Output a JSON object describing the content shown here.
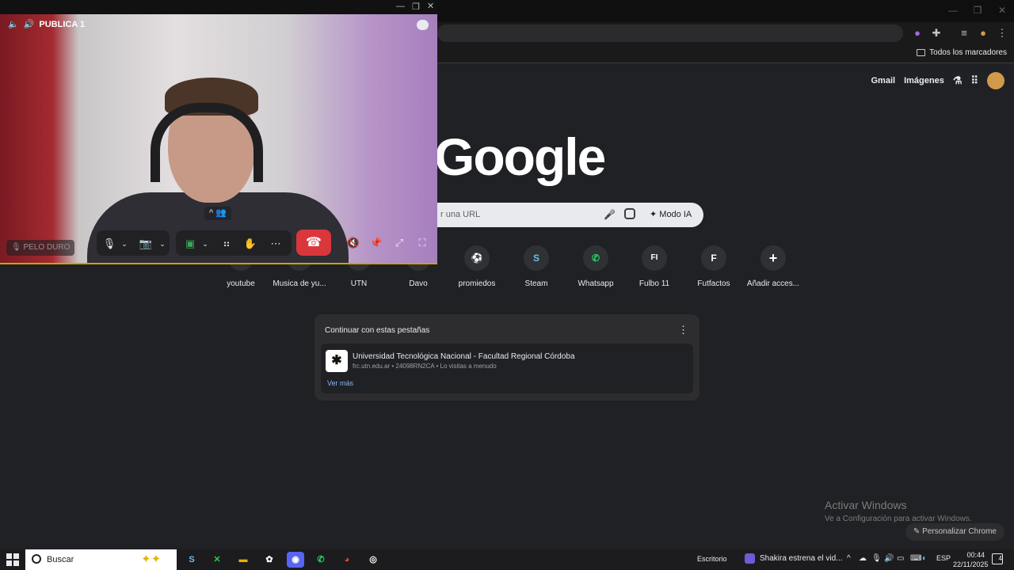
{
  "chrome": {
    "bookmarks_all": "Todos los marcadores",
    "topnav": {
      "gmail": "Gmail",
      "images": "Imágenes"
    },
    "logo": "Google",
    "search_placeholder": "r una URL",
    "mode_ai": "Modo IA",
    "shortcuts": [
      {
        "label": "youtube",
        "icon": "youtube-icon"
      },
      {
        "label": "Musica de yu...",
        "icon": "music-icon"
      },
      {
        "label": "UTN",
        "icon": "utn-icon"
      },
      {
        "label": "Davo",
        "icon": "davo-icon"
      },
      {
        "label": "promiedos",
        "icon": "soccer-ball-icon",
        "glyph": "⚽"
      },
      {
        "label": "Steam",
        "icon": "steam-icon",
        "glyph": "S"
      },
      {
        "label": "Whatsapp",
        "icon": "whatsapp-icon",
        "glyph": "✆"
      },
      {
        "label": "Fulbo 11",
        "icon": "fulbo-icon",
        "glyph": "FI"
      },
      {
        "label": "Futfactos",
        "icon": "futfactos-icon",
        "glyph": "F"
      },
      {
        "label": "Añadir acces...",
        "icon": "plus-icon",
        "glyph": "+"
      }
    ],
    "continue_card": {
      "title": "Continuar con estas pestañas",
      "item_name": "Universidad Tecnológica Nacional - Facultad Regional Córdoba",
      "item_meta": "frc.utn.edu.ar • 24098RN2CA • Lo visitas a menudo",
      "link": "Ver más"
    },
    "customize": "Personalizar Chrome"
  },
  "watermark": {
    "line1": "Activar Windows",
    "line2": "Ve a Configuración para activar Windows."
  },
  "call": {
    "channel": "PUBLICA 1",
    "user": "PELO DURO"
  },
  "taskbar": {
    "search": "Buscar",
    "desktop": "Escritorio",
    "news": "Shakira estrena el vid...",
    "lang": "ESP",
    "time": "00:44",
    "date": "22/11/2025",
    "notifications": "4"
  },
  "colors": {
    "hangup": "#da373c",
    "accent_link": "#8ab4f8",
    "call_border": "#c7a600"
  }
}
